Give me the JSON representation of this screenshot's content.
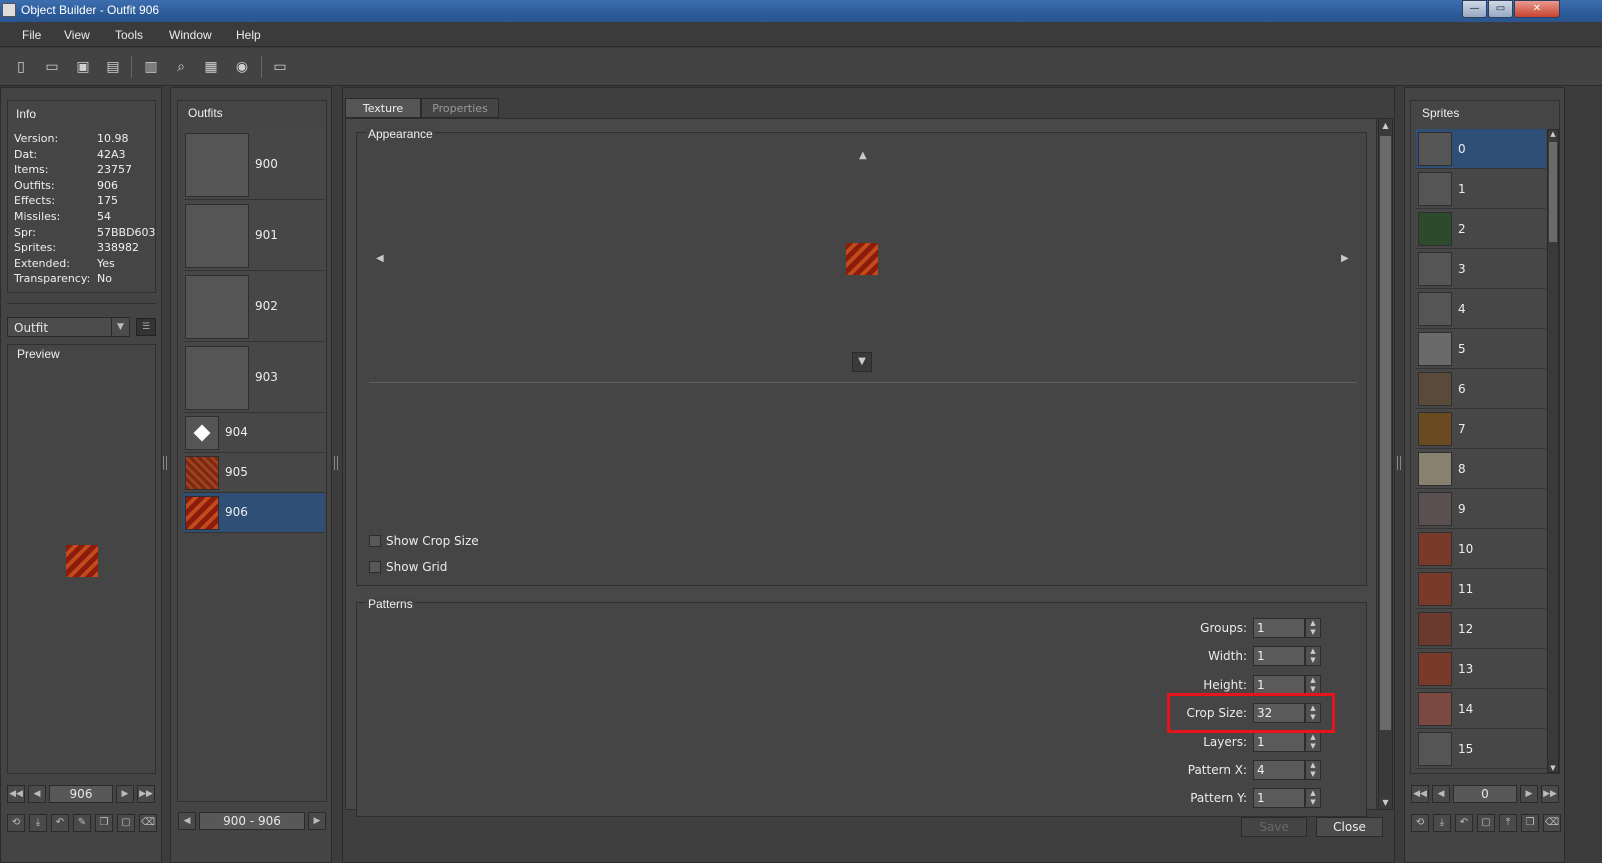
{
  "window": {
    "title": "Object Builder - Outfit 906",
    "min_label": "—",
    "max_label": "▭",
    "close_label": "✕"
  },
  "menu": [
    "File",
    "View",
    "Tools",
    "Window",
    "Help"
  ],
  "toolbar_icons": [
    "new-file-icon",
    "open-folder-icon",
    "save-icon",
    "save-as-icon",
    "compile-icon",
    "find-icon",
    "sprite-viewer-icon",
    "animation-icon",
    "settings-icon"
  ],
  "info": {
    "title": "Info",
    "rows": [
      {
        "k": "Version:",
        "v": "10.98"
      },
      {
        "k": "Dat:",
        "v": "42A3"
      },
      {
        "k": "Items:",
        "v": "23757"
      },
      {
        "k": "Outfits:",
        "v": "906"
      },
      {
        "k": "Effects:",
        "v": "175"
      },
      {
        "k": "Missiles:",
        "v": "54"
      },
      {
        "k": "Spr:",
        "v": "57BBD603"
      },
      {
        "k": "Sprites:",
        "v": "338982"
      },
      {
        "k": "Extended:",
        "v": "Yes"
      },
      {
        "k": "Transparency:",
        "v": "No"
      }
    ]
  },
  "type_select": {
    "value": "Outfit"
  },
  "preview": {
    "title": "Preview"
  },
  "left_nav": {
    "value": "906"
  },
  "outfits": {
    "title": "Outfits",
    "items": [
      {
        "id": "900"
      },
      {
        "id": "901"
      },
      {
        "id": "902"
      },
      {
        "id": "903"
      },
      {
        "id": "904"
      },
      {
        "id": "905"
      },
      {
        "id": "906"
      }
    ],
    "range": "900 - 906"
  },
  "tabs": {
    "texture": "Texture",
    "properties": "Properties"
  },
  "appearance": {
    "title": "Appearance",
    "show_crop": "Show Crop Size",
    "show_grid": "Show Grid"
  },
  "patterns": {
    "title": "Patterns",
    "rows": [
      {
        "label": "Groups:",
        "value": "1"
      },
      {
        "label": "Width:",
        "value": "1"
      },
      {
        "label": "Height:",
        "value": "1"
      },
      {
        "label": "Crop Size:",
        "value": "32"
      },
      {
        "label": "Layers:",
        "value": "1"
      },
      {
        "label": "Pattern X:",
        "value": "4"
      },
      {
        "label": "Pattern Y:",
        "value": "1"
      }
    ]
  },
  "buttons": {
    "save": "Save",
    "close": "Close"
  },
  "sprites": {
    "title": "Sprites",
    "items": [
      "0",
      "1",
      "2",
      "3",
      "4",
      "5",
      "6",
      "7",
      "8",
      "9",
      "10",
      "11",
      "12",
      "13",
      "14",
      "15"
    ],
    "nav_value": "0"
  },
  "colors": {
    "selected": "#2f4f77",
    "highlight": "#e8141c"
  }
}
